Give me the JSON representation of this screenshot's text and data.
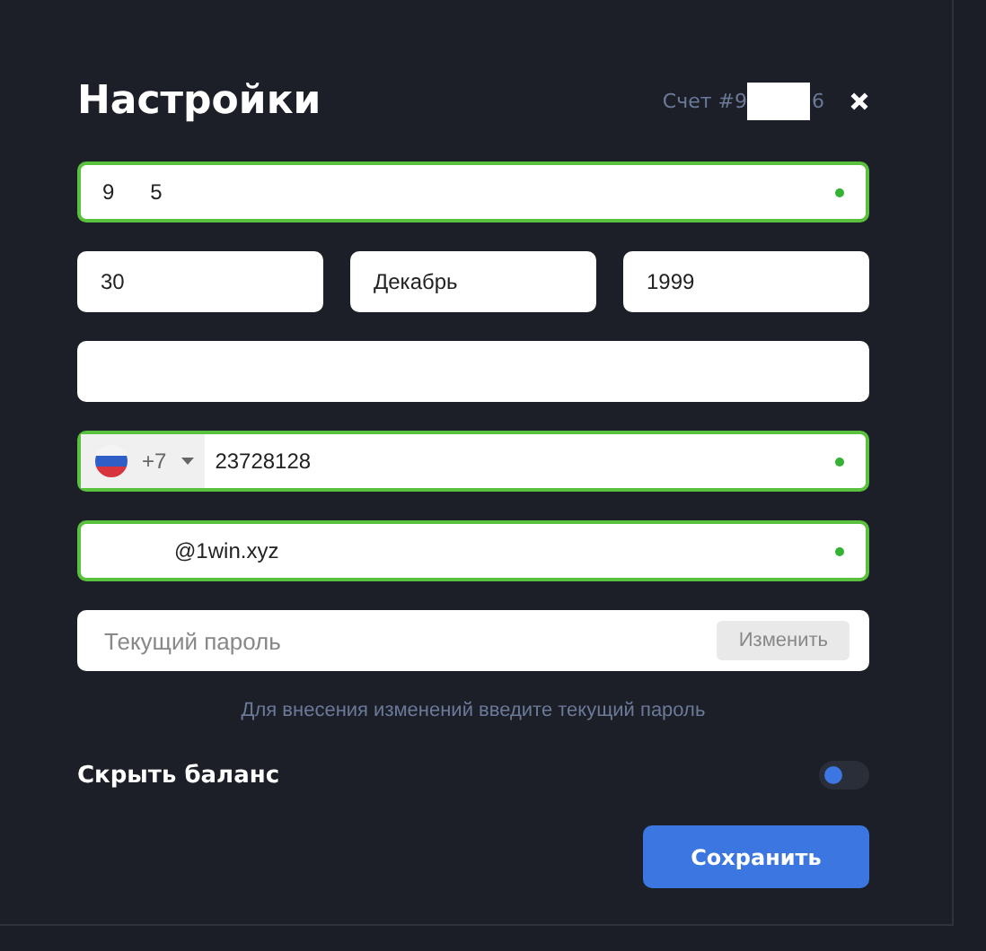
{
  "dialog": {
    "title": "Настройки",
    "account_prefix": "Счет #9",
    "account_suffix": "6",
    "redacted": true
  },
  "name_field": {
    "value": "9      5",
    "valid": true
  },
  "birth_date": [
    {
      "value": "30"
    },
    {
      "value": "Декабрь"
    },
    {
      "value": "1999"
    }
  ],
  "blank_field": {
    "valid": false
  },
  "phone_field": {
    "code": "+7",
    "value": "23728128",
    "valid": true
  },
  "email_field": {
    "value": "@1win.xyz",
    "valid": true
  },
  "password_field": {
    "placeholder": "Текущий пароль",
    "button": "Изменить"
  },
  "hint": "Для внесения изменений введите текущий пароль",
  "hide_balance": {
    "label": "Скрыть баланс",
    "on": false
  },
  "save_button": "Сохранить"
}
